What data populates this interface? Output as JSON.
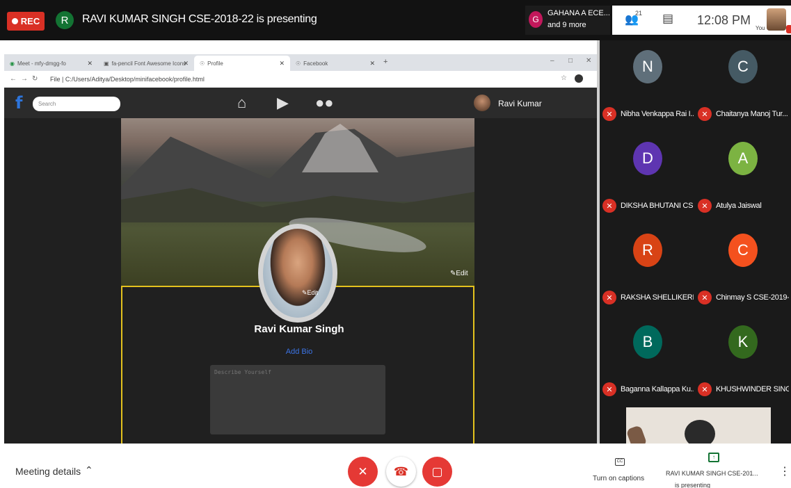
{
  "topbar": {
    "rec_label": "REC",
    "presenter_initial": "R",
    "presenter_text": "RAVI KUMAR SINGH CSE-2018-22 is presenting",
    "participant_initial": "G",
    "participant_line1": "GAHANA A ECE...",
    "participant_line2": "and 9 more",
    "people_count": "21",
    "time": "12:08 PM",
    "you_label": "You"
  },
  "browser": {
    "tabs": [
      {
        "label": "Meet - mfy-dmgg-fo",
        "icon": "meet-icon"
      },
      {
        "label": "fa-pencil Font Awesome Icons",
        "icon": "fontawesome-icon"
      },
      {
        "label": "Profile",
        "icon": "globe-icon"
      },
      {
        "label": "Facebook",
        "icon": "globe-icon"
      }
    ],
    "url": "File | C:/Users/Aditya/Desktop/minifacebook/profile.html"
  },
  "fb": {
    "logo": "f",
    "search_placeholder": "Search",
    "user_name": "Ravi Kumar",
    "cover_edit": "✎Edit",
    "avatar_edit": "✎Edit",
    "profile_name": "Ravi Kumar Singh",
    "add_bio": "Add Bio",
    "bio_placeholder": "Describe Yourself"
  },
  "participants": [
    {
      "initial": "N",
      "name": "Nibha Venkappa Rai I...",
      "color": "#5f6f7a"
    },
    {
      "initial": "C",
      "name": "Chaitanya Manoj Tur...",
      "color": "#455a64"
    },
    {
      "initial": "D",
      "name": "DIKSHA BHUTANI CS...",
      "color": "#5e35b1"
    },
    {
      "initial": "A",
      "name": "Atulya Jaiswal",
      "color": "#7cb342"
    },
    {
      "initial": "R",
      "name": "RAKSHA SHELLIKERI ...",
      "color": "#d84315"
    },
    {
      "initial": "C",
      "name": "Chinmay S CSE-2019-...",
      "color": "#f4511e"
    },
    {
      "initial": "B",
      "name": "Baganna Kallappa Ku...",
      "color": "#00695c"
    },
    {
      "initial": "K",
      "name": "KHUSHWINDER SING...",
      "color": "#33691e"
    }
  ],
  "bottombar": {
    "meeting_details": "Meeting details",
    "captions_label": "Turn on captions",
    "captions_icon": "CC",
    "presenting_line1": "RAVI KUMAR SINGH CSE-201...",
    "presenting_line2": "is presenting"
  },
  "colors": {
    "accent_red": "#e53935",
    "fb_blue": "#2d74da",
    "card_border": "#e4c21d"
  }
}
